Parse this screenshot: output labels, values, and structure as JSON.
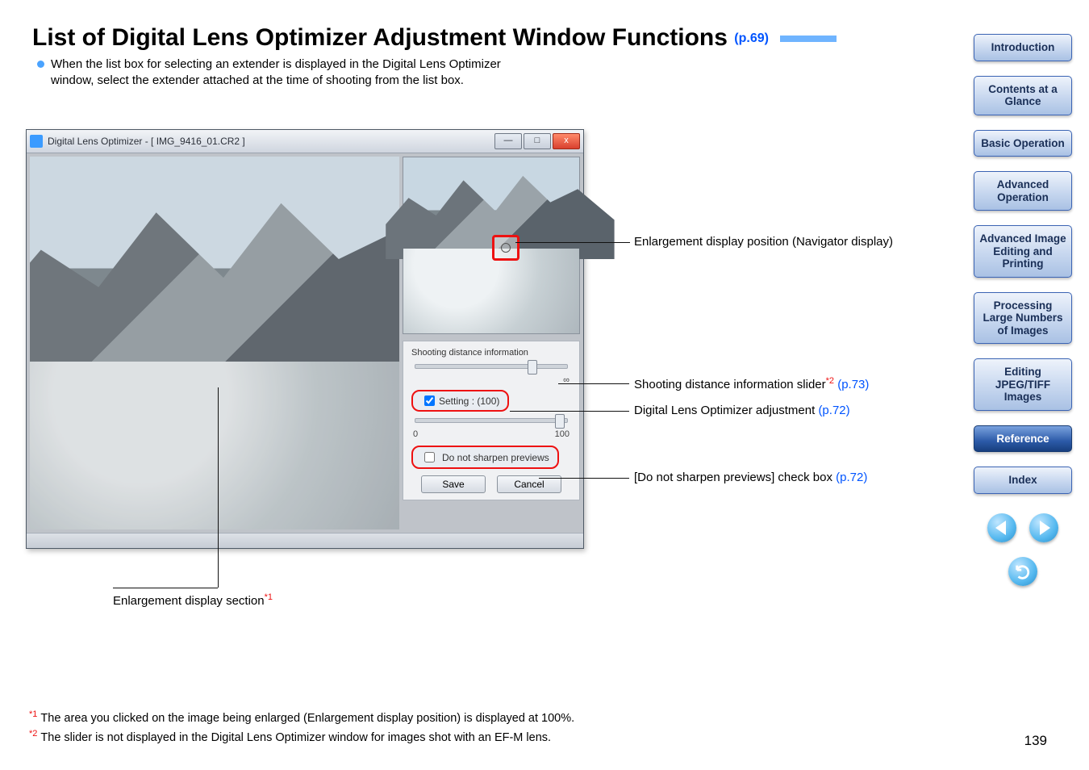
{
  "heading": {
    "title": "List of Digital Lens Optimizer Adjustment Window Functions",
    "page_ref": "(p.69)"
  },
  "intro": "When the list box for selecting an extender is displayed in the Digital Lens Optimizer window, select the extender attached at the time of shooting from the list box.",
  "window": {
    "title": "Digital Lens Optimizer - [ IMG_9416_01.CR2 ]",
    "shooting_label": "Shooting distance information",
    "infinity": "∞",
    "setting_label": "Setting : (100)",
    "scale_min": "0",
    "scale_max": "100",
    "sharpen_label": "Do not sharpen previews",
    "save": "Save",
    "cancel": "Cancel"
  },
  "callouts": {
    "nav": "Enlargement display position (Navigator display)",
    "slider_text": "Shooting distance information slider",
    "slider_star": "*2",
    "slider_ref": " (p.73)",
    "adjust_text": "Digital Lens Optimizer adjustment ",
    "adjust_ref": "(p.72)",
    "sharp_text": "[Do not sharpen previews] check box ",
    "sharp_ref": "(p.72)",
    "enlarge_text": "Enlargement display section",
    "enlarge_star": "*1"
  },
  "footnotes": {
    "f1_mark": "*1",
    "f1": "The area you clicked on the image being enlarged (Enlargement display position) is displayed at 100%.",
    "f2_mark": "*2",
    "f2": "The slider is not displayed in the Digital Lens Optimizer window for images shot with an EF-M lens."
  },
  "sidebar": {
    "items": [
      "Introduction",
      "Contents at a Glance",
      "Basic Operation",
      "Advanced Operation",
      "Advanced Image Editing and Printing",
      "Processing Large Numbers of Images",
      "Editing JPEG/TIFF Images",
      "Reference",
      "Index"
    ],
    "active_index": 7
  },
  "page_number": "139"
}
